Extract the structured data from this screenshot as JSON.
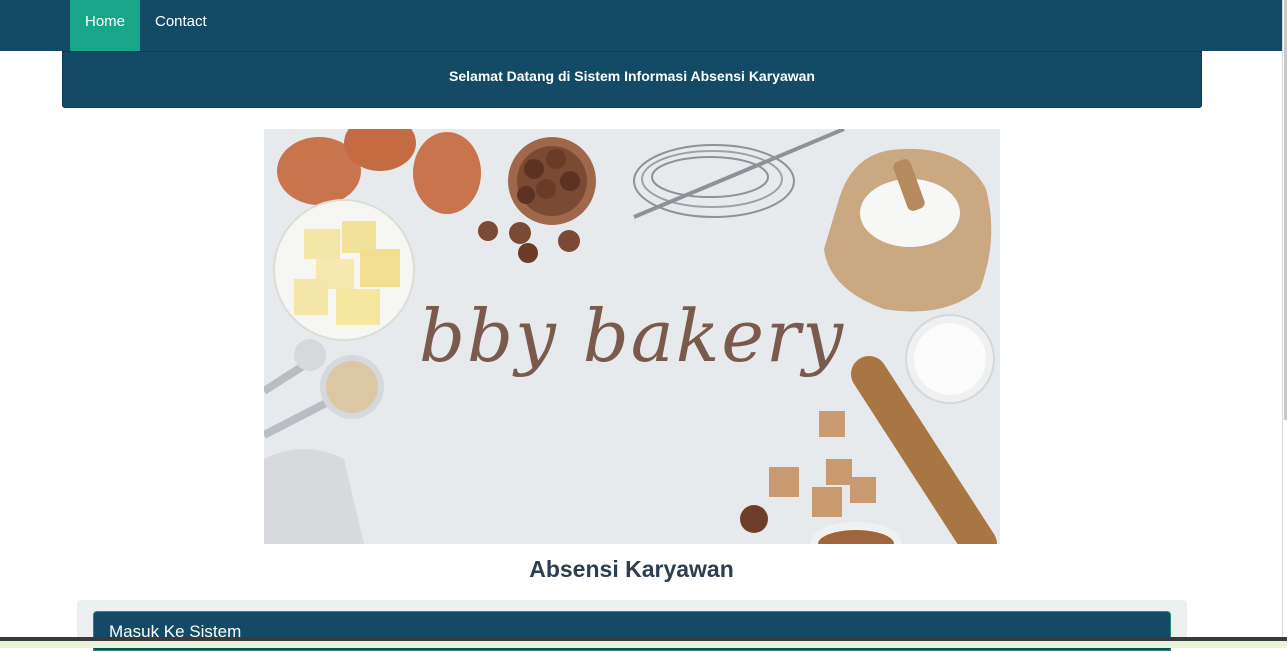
{
  "nav": {
    "home_label": "Home",
    "contact_label": "Contact"
  },
  "header": {
    "welcome_text": "Selamat Datang di Sistem Informasi Absensi Karyawan"
  },
  "hero": {
    "brand_text": "bby bakery"
  },
  "main": {
    "heading": "Absensi Karyawan",
    "login_panel_title": "Masuk Ke Sistem"
  },
  "colors": {
    "navbar": "#134b67",
    "active_nav": "#18a689",
    "heading_text": "#2d3e50",
    "panel_bg": "#ecf0f1"
  }
}
